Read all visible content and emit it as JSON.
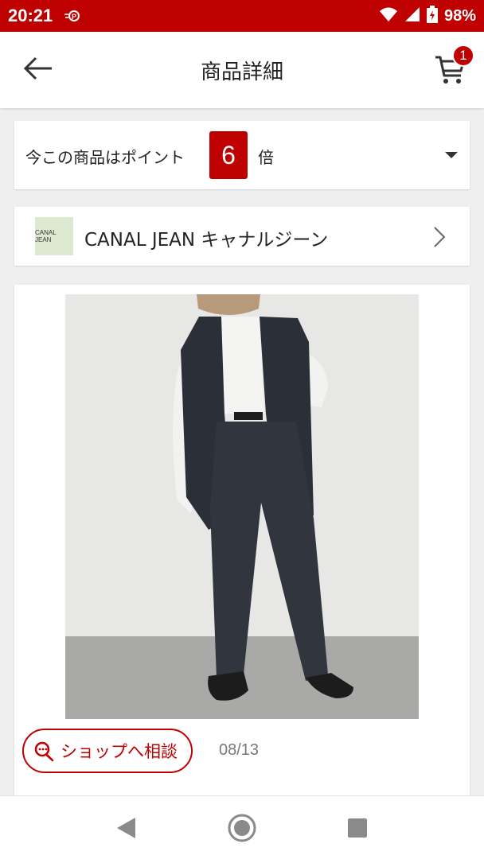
{
  "status_bar": {
    "time": "20:21",
    "battery": "98%",
    "icons": [
      "pay-icon",
      "wifi-icon",
      "signal-icon",
      "battery-icon"
    ]
  },
  "header": {
    "title": "商品詳細",
    "cart_count": "1",
    "icons": [
      "back-arrow-icon",
      "cart-icon"
    ]
  },
  "points": {
    "prefix": "今この商品はポイント",
    "multiplier": "6",
    "suffix": "倍"
  },
  "shop": {
    "logo_text": "CANAL JEAN",
    "name": "CANAL JEAN キャナルジーン"
  },
  "product": {
    "consult_label": "ショップへ相談",
    "date": "08/13"
  },
  "colors": {
    "brand_red": "#bf0000",
    "background": "#efefef"
  },
  "nav_bar": {
    "icons": [
      "nav-back-icon",
      "nav-home-icon",
      "nav-recents-icon"
    ]
  }
}
